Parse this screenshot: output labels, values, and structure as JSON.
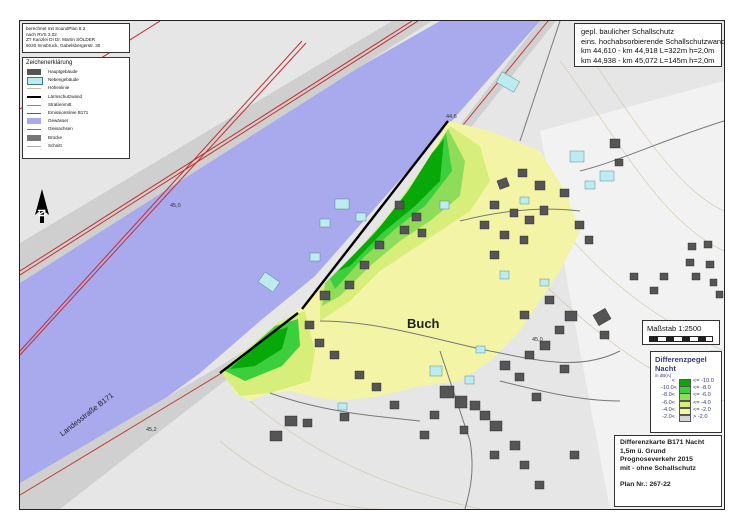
{
  "calc_note": {
    "lines": [
      "berechnet mit SoundPlan 8.2",
      "nach RVS 3.02",
      "ZT Kanzlei DI Dr. Martin SÖLDER",
      "6020 Innsbruck, Gabelsbergerstr. 30"
    ]
  },
  "legend": {
    "title": "Zeichenerklärung",
    "items": [
      {
        "label": "Hauptgebäude",
        "color": "#555555"
      },
      {
        "label": "Nebengebäude",
        "color": "#bdebef"
      },
      {
        "label": "Höhenlinie",
        "color": "#c9b9a0"
      },
      {
        "label": "Lärmschutzwand",
        "color": "#000000"
      },
      {
        "label": "Straßenmitt",
        "color": "#888888"
      },
      {
        "label": "Emissionslinie B171",
        "color": "#c03030"
      },
      {
        "label": "Gewässer",
        "color": "#a9a9ee"
      },
      {
        "label": "Gleisachsen",
        "color": "#cc44aa"
      },
      {
        "label": "Brücke",
        "color": "#777777"
      },
      {
        "label": "Schnitt",
        "color": "#aaaaaa"
      }
    ]
  },
  "project_info": {
    "lines": [
      "gepl. baulicher Schallschutz",
      "eins. hochabsorbierende Schallschutzwand",
      "km 44,610 - km 44,918   L=322m   h=2,0m",
      "km 44,938 - km 45,072   L=145m   h=2,0m"
    ]
  },
  "map": {
    "place_name": "Buch",
    "road_name": "Landesstraße B171",
    "km_labels": [
      "44,6",
      "45,0",
      "45,2",
      "45,0"
    ],
    "colors": {
      "water": "#a9a9ee",
      "land": "#e6e6e6",
      "road": "#c9c9c9",
      "emission_line": "#c03030",
      "noise_wall": "#000000",
      "building_main": "#555555",
      "building_aux": "#bdebef"
    }
  },
  "scale": {
    "label": "Maßstab 1:2500"
  },
  "diff_legend": {
    "title_1": "Differenzpegel",
    "title_2": "Nacht",
    "unit": "in dB(A)",
    "rows": [
      {
        "a": "<",
        "b": "<= -10.0",
        "color": "#08a808"
      },
      {
        "a": "-10.0<",
        "b": "<= -8.0",
        "color": "#3cce3c"
      },
      {
        "a": "-8.0<",
        "b": "<= -6.0",
        "color": "#8edc5a"
      },
      {
        "a": "-6.0<",
        "b": "<= -4.0",
        "color": "#d8ee7a"
      },
      {
        "a": "-4.0<",
        "b": "<= -2.0",
        "color": "#f4f4a6"
      },
      {
        "a": "-2.0<",
        "b": "> -2.0",
        "color": "#d6d6d6"
      }
    ]
  },
  "plan_box": {
    "lines": [
      "Differenzkarte B171 Nacht",
      "1,5m ü. Grund",
      "Prognoseverkehr 2015",
      "mit - ohne Schallschutz"
    ],
    "plan_no": "Plan Nr.: 267-22"
  }
}
